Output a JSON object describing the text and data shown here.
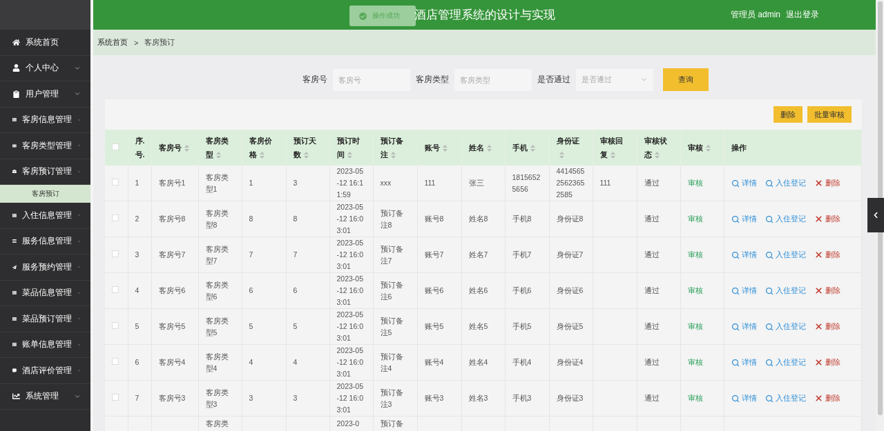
{
  "header": {
    "title": "酒店管理系统的设计与实现",
    "user": "管理员 admin",
    "logout": "退出登录"
  },
  "toast": {
    "message": "操作成功"
  },
  "sidebar": {
    "items": [
      {
        "label": "系统首页"
      },
      {
        "label": "个人中心",
        "expanded": false
      },
      {
        "label": "用户管理",
        "expanded": false
      },
      {
        "label": "客房信息管理",
        "expanded": false
      },
      {
        "label": "客房类型管理",
        "expanded": false
      },
      {
        "label": "客房预订管理",
        "expanded": true,
        "children": [
          {
            "label": "客房预订",
            "selected": true
          }
        ]
      },
      {
        "label": "入住信息管理",
        "expanded": false
      },
      {
        "label": "服务信息管理",
        "expanded": false
      },
      {
        "label": "服务预约管理",
        "expanded": false
      },
      {
        "label": "菜品信息管理",
        "expanded": false
      },
      {
        "label": "菜品预订管理",
        "expanded": false
      },
      {
        "label": "账单信息管理",
        "expanded": false
      },
      {
        "label": "酒店评价管理",
        "expanded": false
      },
      {
        "label": "系统管理",
        "expanded": false
      }
    ]
  },
  "breadcrumb": {
    "items": [
      "系统首页",
      "客房预订"
    ],
    "separator": ">"
  },
  "search": {
    "fields": [
      {
        "kind": "input",
        "label": "客房号",
        "placeholder": "客房号"
      },
      {
        "kind": "input",
        "label": "客房类型",
        "placeholder": "客房类型"
      },
      {
        "kind": "select",
        "label": "是否通过",
        "placeholder": "是否通过"
      }
    ],
    "button": "查询"
  },
  "toolbar": {
    "buttons": [
      "删除",
      "批量审核"
    ]
  },
  "table": {
    "select_all_checked": false,
    "columns": [
      {
        "label": "序.号.",
        "sortable": false
      },
      {
        "label": "客房号",
        "sortable": true
      },
      {
        "label": "客房类型",
        "sortable": true
      },
      {
        "label": "客房价格",
        "sortable": true
      },
      {
        "label": "预订天数",
        "sortable": true
      },
      {
        "label": "预订时间",
        "sortable": true
      },
      {
        "label": "预订备注",
        "sortable": true
      },
      {
        "label": "账号",
        "sortable": true
      },
      {
        "label": "姓名",
        "sortable": true
      },
      {
        "label": "手机",
        "sortable": true
      },
      {
        "label": "身份证",
        "sortable": true
      },
      {
        "label": "审核回复",
        "sortable": true
      },
      {
        "label": "审核状态",
        "sortable": true
      },
      {
        "label": "审核",
        "sortable": true
      },
      {
        "label": "操作",
        "sortable": false
      }
    ],
    "rows": [
      {
        "checked": false,
        "cells": [
          "1",
          "客房号1",
          "客房类型1",
          "1",
          "3",
          "2023-05-12 16:11:59",
          "xxx",
          "111",
          "张三",
          "18156525656",
          "441456525623652585",
          "111",
          "通过"
        ],
        "audit": "审核",
        "actions": [
          "详情",
          "入住登记",
          "删除"
        ]
      },
      {
        "checked": false,
        "cells": [
          "2",
          "客房号8",
          "客房类型8",
          "8",
          "8",
          "2023-05-12 16:03:01",
          "预订备注8",
          "账号8",
          "姓名8",
          "手机8",
          "身份证8",
          null,
          "通过"
        ],
        "audit": "审核",
        "actions": [
          "详情",
          "入住登记",
          "删除"
        ]
      },
      {
        "checked": false,
        "cells": [
          "3",
          "客房号7",
          "客房类型7",
          "7",
          "7",
          "2023-05-12 16:03:01",
          "预订备注7",
          "账号7",
          "姓名7",
          "手机7",
          "身份证7",
          null,
          "通过"
        ],
        "audit": "审核",
        "actions": [
          "详情",
          "入住登记",
          "删除"
        ]
      },
      {
        "checked": false,
        "cells": [
          "4",
          "客房号6",
          "客房类型6",
          "6",
          "6",
          "2023-05-12 16:03:01",
          "预订备注6",
          "账号6",
          "姓名6",
          "手机6",
          "身份证6",
          null,
          "通过"
        ],
        "audit": "审核",
        "actions": [
          "详情",
          "入住登记",
          "删除"
        ]
      },
      {
        "checked": false,
        "cells": [
          "5",
          "客房号5",
          "客房类型5",
          "5",
          "5",
          "2023-05-12 16:03:01",
          "预订备注5",
          "账号5",
          "姓名5",
          "手机5",
          "身份证5",
          null,
          "通过"
        ],
        "audit": "审核",
        "actions": [
          "详情",
          "入住登记",
          "删除"
        ]
      },
      {
        "checked": false,
        "cells": [
          "6",
          "客房号4",
          "客房类型4",
          "4",
          "4",
          "2023-05-12 16:03:01",
          "预订备注4",
          "账号4",
          "姓名4",
          "手机4",
          "身份证4",
          null,
          "通过"
        ],
        "audit": "审核",
        "actions": [
          "详情",
          "入住登记",
          "删除"
        ]
      },
      {
        "checked": false,
        "cells": [
          "7",
          "客房号3",
          "客房类型3",
          "3",
          "3",
          "2023-05-12 16:03:01",
          "预订备注3",
          "账号3",
          "姓名3",
          "手机3",
          "身份证3",
          null,
          "通过"
        ],
        "audit": "审核",
        "actions": [
          "详情",
          "入住登记",
          "删除"
        ]
      },
      {
        "cells": [
          null,
          null,
          "客房类",
          null,
          null,
          "2023-0",
          "预订备",
          null,
          null,
          null,
          null,
          null,
          null
        ]
      }
    ]
  }
}
